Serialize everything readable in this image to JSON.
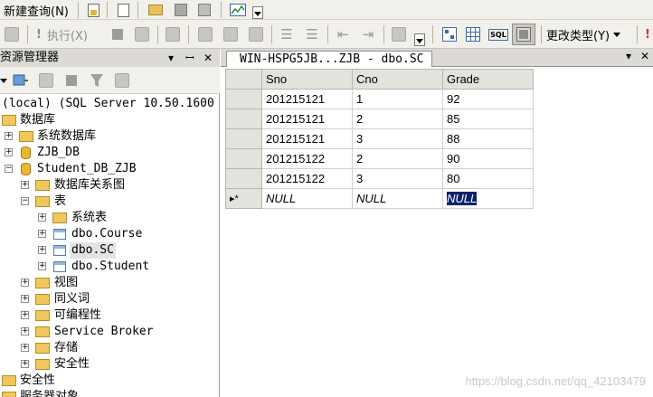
{
  "toolbar1": {
    "new_query_label": "新建查询(N)"
  },
  "toolbar2": {
    "execute_label": "执行(X)",
    "change_type_label": "更改类型(Y)",
    "sql_icon_text": "SQL"
  },
  "object_explorer": {
    "title": "资源管理器",
    "pin_symbol": "▾ ᚹ ✕",
    "tree": [
      {
        "label": "(local) (SQL Server 10.50.1600",
        "icon": "server-icon"
      },
      {
        "label": "数据库",
        "icon": "folder-icon"
      },
      {
        "label": "系统数据库",
        "icon": "folder-icon"
      },
      {
        "label": "ZJB_DB",
        "icon": "database-icon"
      },
      {
        "label": "Student_DB_ZJB",
        "icon": "database-icon"
      },
      {
        "label": "数据库关系图",
        "icon": "folder-icon"
      },
      {
        "label": "表",
        "icon": "folder-icon"
      },
      {
        "label": "系统表",
        "icon": "folder-icon"
      },
      {
        "label": "dbo.Course",
        "icon": "table-icon"
      },
      {
        "label": "dbo.SC",
        "icon": "table-icon"
      },
      {
        "label": "dbo.Student",
        "icon": "table-icon"
      },
      {
        "label": "视图",
        "icon": "folder-icon"
      },
      {
        "label": "同义词",
        "icon": "folder-icon"
      },
      {
        "label": "可编程性",
        "icon": "folder-icon"
      },
      {
        "label": "Service Broker",
        "icon": "folder-icon"
      },
      {
        "label": "存储",
        "icon": "folder-icon"
      },
      {
        "label": "安全性",
        "icon": "folder-icon"
      },
      {
        "label": "安全性",
        "icon": "folder-icon"
      },
      {
        "label": "服务器对象",
        "icon": "folder-icon"
      }
    ]
  },
  "document_tab": {
    "title": "WIN-HSPG5JB...ZJB - dbo.SC"
  },
  "grid": {
    "columns": [
      "Sno",
      "Cno",
      "Grade"
    ],
    "rows": [
      [
        "201215121",
        "1",
        "92"
      ],
      [
        "201215121",
        "2",
        "85"
      ],
      [
        "201215121",
        "3",
        "88"
      ],
      [
        "201215122",
        "2",
        "90"
      ],
      [
        "201215122",
        "3",
        "80"
      ]
    ],
    "new_row": [
      "NULL",
      "NULL",
      "NULL"
    ],
    "new_row_marker": "▸*"
  },
  "watermark": "https://blog.csdn.net/qq_42103479",
  "colors": {
    "selection": "#0a246a",
    "header": "#e4e2dd",
    "toolbar": "#f1f0ea"
  }
}
